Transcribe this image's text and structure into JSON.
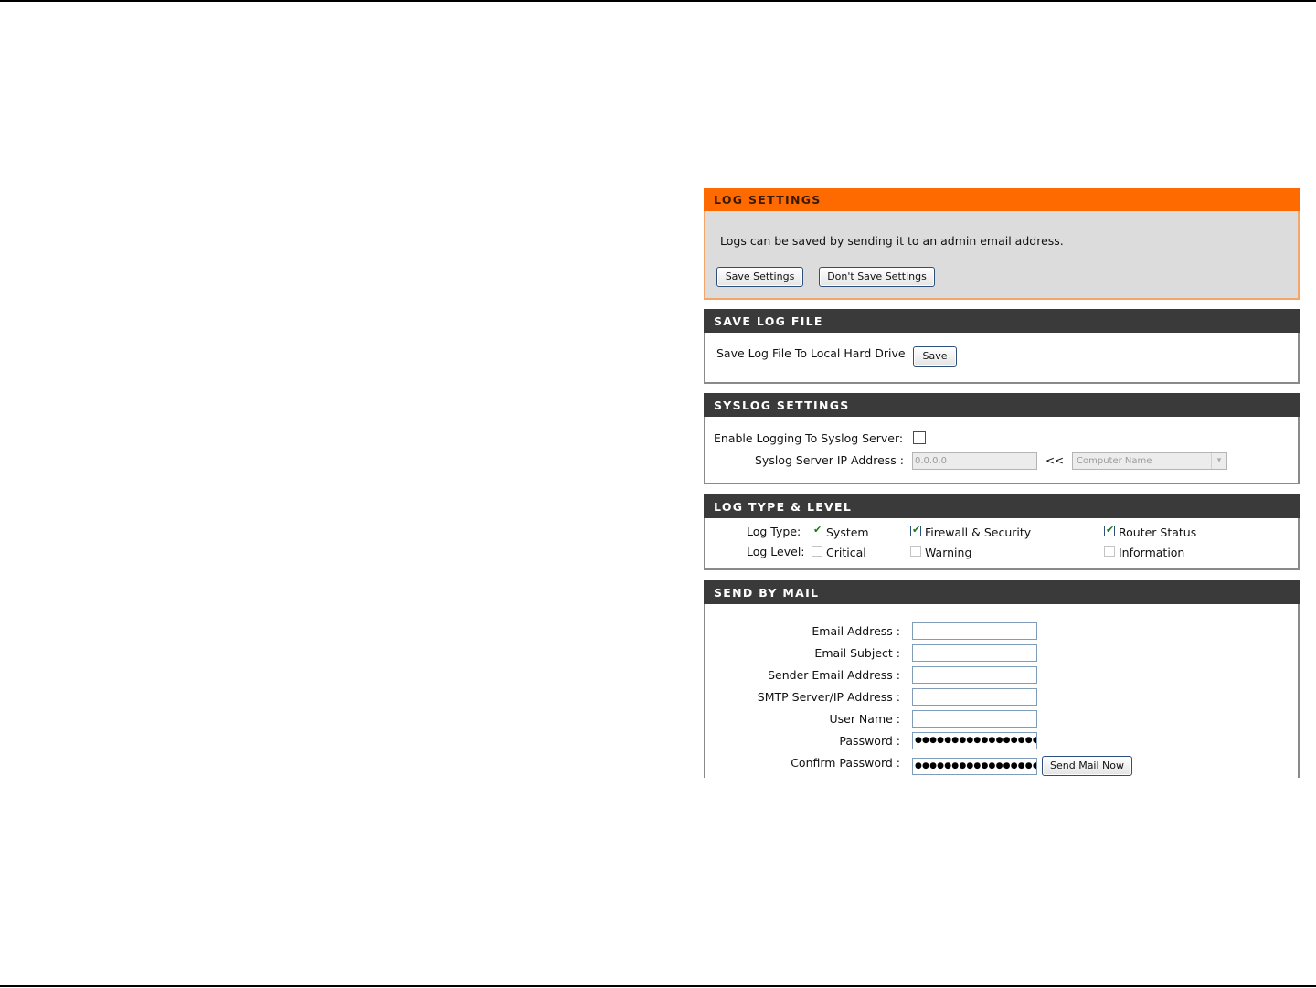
{
  "log_settings": {
    "title": "LOG SETTINGS",
    "description": "Logs can be saved by sending it to an admin email address.",
    "save_button": "Save Settings",
    "dont_save_button": "Don't Save Settings"
  },
  "save_log_file": {
    "title": "SAVE LOG FILE",
    "label": "Save Log File To Local Hard Drive",
    "save_button": "Save"
  },
  "syslog": {
    "title": "SYSLOG SETTINGS",
    "enable_label": "Enable Logging To Syslog Server:",
    "enable_checked": false,
    "ip_label": "Syslog Server IP Address :",
    "ip_value": "0.0.0.0",
    "arrow_button": "<<",
    "computer_select": "Computer Name"
  },
  "log_type": {
    "title": "LOG TYPE & LEVEL",
    "type_label": "Log Type:",
    "level_label": "Log Level:",
    "types": [
      {
        "label": "System",
        "checked": true
      },
      {
        "label": "Firewall & Security",
        "checked": true
      },
      {
        "label": "Router Status",
        "checked": true
      }
    ],
    "levels": [
      {
        "label": "Critical",
        "checked": false
      },
      {
        "label": "Warning",
        "checked": false
      },
      {
        "label": "Information",
        "checked": false
      }
    ]
  },
  "send_by_mail": {
    "title": "SEND BY MAIL",
    "email_label": "Email Address :",
    "email_value": "",
    "subject_label": "Email Subject :",
    "subject_value": "",
    "sender_label": "Sender Email Address :",
    "sender_value": "",
    "smtp_label": "SMTP Server/IP Address :",
    "smtp_value": "",
    "username_label": "User Name :",
    "username_value": "",
    "password_label": "Password :",
    "password_value": "●●●●●●●●●●●●●●●●●●",
    "confirm_label": "Confirm Password :",
    "confirm_value": "●●●●●●●●●●●●●●●●●●",
    "send_button": "Send Mail Now"
  },
  "icons": {
    "check": "✔",
    "dropdown": "▾"
  }
}
